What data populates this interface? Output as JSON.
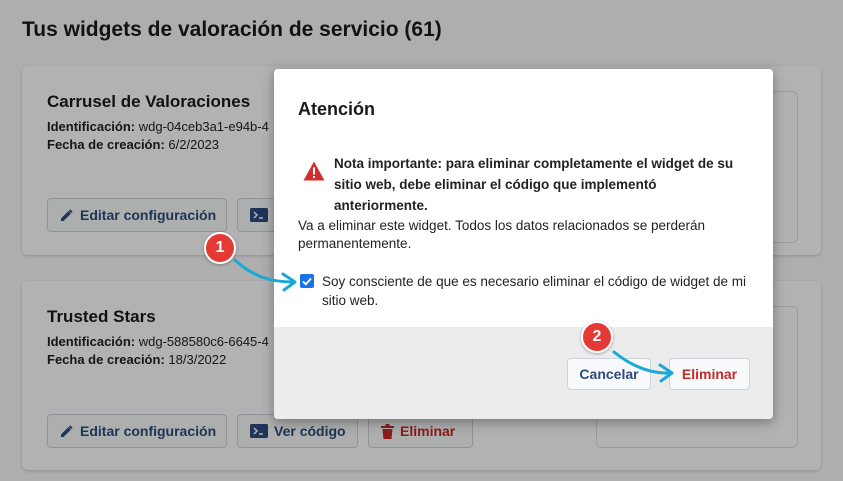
{
  "page": {
    "title": "Tus widgets de valoración de servicio (61)"
  },
  "cards": [
    {
      "title": "Carrusel de Valoraciones",
      "id_label": "Identificación:",
      "id_value": "wdg-04ceb3a1-e94b-4",
      "date_label": "Fecha de creación:",
      "date_value": "6/2/2023",
      "edit_label": "Editar configuración"
    },
    {
      "title": "Trusted Stars",
      "id_label": "Identificación:",
      "id_value": "wdg-588580c6-6645-4",
      "date_label": "Fecha de creación:",
      "date_value": "18/3/2022",
      "edit_label": "Editar configuración",
      "code_label": "Ver código",
      "delete_label": "Eliminar"
    }
  ],
  "modal": {
    "title": "Atención",
    "warning": "Nota importante: para eliminar completamente el widget de su sitio web, debe eliminar el código que implementó anteriormente.",
    "body": "Va a eliminar este widget. Todos los datos relacionados se perderán permanentemente.",
    "confirm_label": "Soy consciente de que es necesario eliminar el código de widget de mi sitio web.",
    "confirm_checked": true,
    "cancel_label": "Cancelar",
    "delete_label": "Eliminar"
  },
  "annotations": {
    "step1": "1",
    "step2": "2"
  },
  "colors": {
    "accent_blue": "#2b4c7e",
    "danger_red": "#c62828",
    "checkbox_blue": "#1a73e8",
    "marker_red": "#e53935",
    "arrow_cyan": "#19a9d6"
  }
}
